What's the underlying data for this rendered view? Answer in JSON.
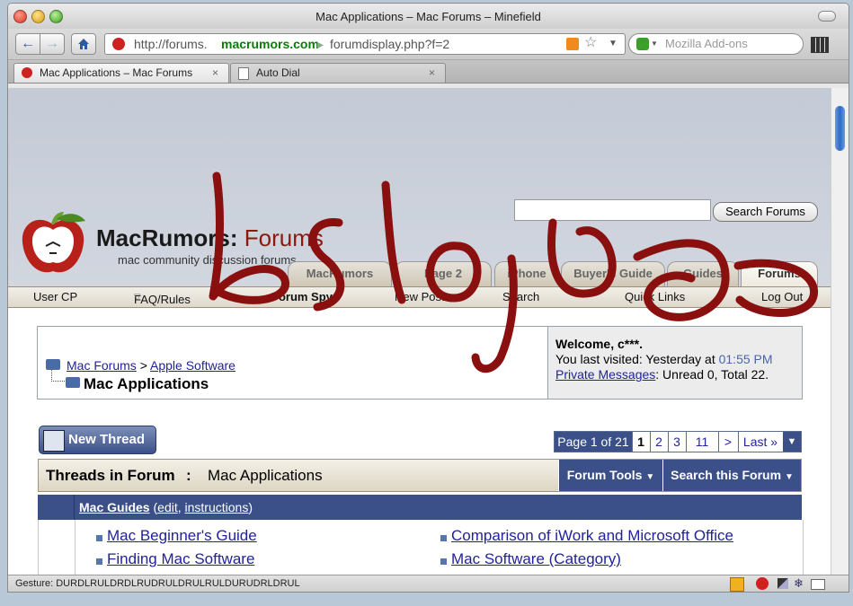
{
  "window": {
    "title": "Mac Applications – Mac Forums – Minefield"
  },
  "toolbar": {
    "url_scheme": "http://forums.",
    "url_domain": "macrumors.com",
    "url_path": "forumdisplay.php?f=2",
    "search_placeholder": "Mozilla Add-ons"
  },
  "tabs": [
    {
      "label": "Mac Applications – Mac Forums",
      "close": "×"
    },
    {
      "label": "Auto Dial",
      "close": "×"
    }
  ],
  "site": {
    "logo_brand": "MacRumors",
    "logo_forums": "Forums",
    "logo_tagline": "mac community discussion forums",
    "search_button": "Search Forums",
    "nav_tabs": [
      "MacRumors",
      "Page 2",
      "iPhone",
      "Buyer's Guide",
      "Guides",
      "Forums"
    ],
    "menu": [
      "User CP",
      "FAQ/Rules",
      "Forum Spy",
      "New Posts",
      "Search",
      "Quick Links",
      "Log Out"
    ]
  },
  "breadcrumb": {
    "root": "Mac Forums",
    "separator": ">",
    "parent": "Apple Software",
    "current": "Mac Applications"
  },
  "welcome": {
    "greeting": "Welcome, c***.",
    "last_visit_prefix": "You last visited: Yesterday at",
    "last_visit_time": "01:55 PM",
    "pm_link": "Private Messages",
    "pm_counts": ": Unread 0, Total 22."
  },
  "new_thread_label": "New Thread",
  "pagination": {
    "label": "Page 1 of 21",
    "pages": [
      "1",
      "2",
      "3",
      "11"
    ],
    "next": ">",
    "last": "Last »"
  },
  "threads_header": {
    "title": "Threads in Forum",
    "separator": ":",
    "forum_name": "Mac Applications",
    "forum_tools": "Forum Tools",
    "search_forum": "Search this Forum"
  },
  "guides_bar": {
    "title": "Mac Guides",
    "open_paren": "(",
    "edit": "edit",
    "comma": ",",
    "instructions": "instructions",
    "close_paren": ")"
  },
  "guides": [
    "Mac Beginner's Guide",
    "Comparison of iWork and Microsoft Office",
    "Finding Mac Software",
    "Mac Software (Category)"
  ],
  "statusbar": {
    "gesture": "Gesture: DURDLRULDRDLRUDRULDRULRULDURUDRLDRUL"
  },
  "scribble": {
    "text": "bsloje",
    "color": "#8a0f0f"
  },
  "colors": {
    "accent_blue": "#3b5089",
    "link": "#22229c",
    "brand_red": "#8a1a10"
  }
}
